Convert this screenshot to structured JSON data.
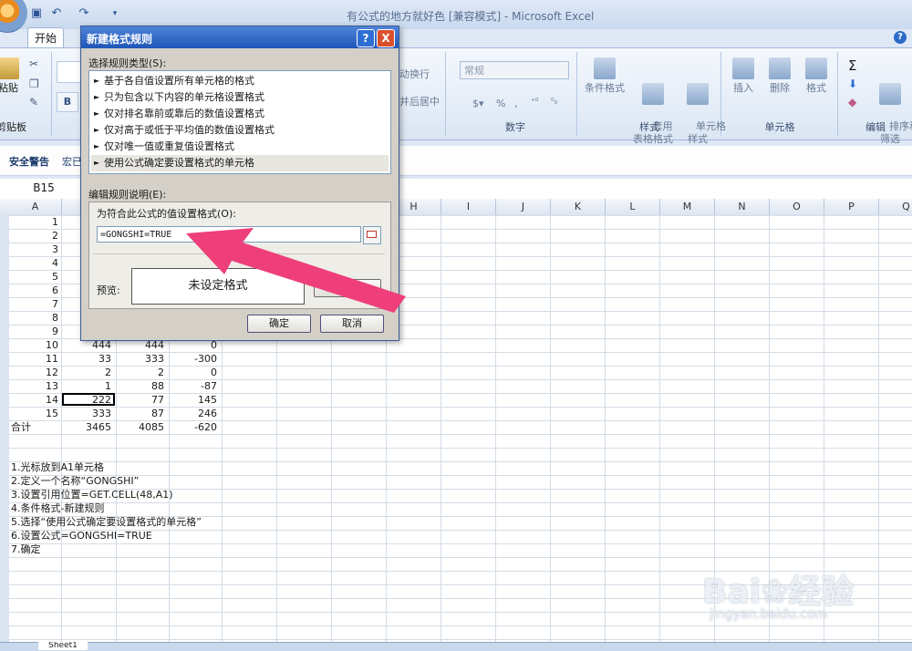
{
  "window": {
    "title": "有公式的地方就好色  [兼容模式] - Microsoft Excel",
    "help": "?"
  },
  "tabs": {
    "home": "开始"
  },
  "ribbon": {
    "paste": "粘贴",
    "clipboard": "剪贴板",
    "bold": "B",
    "wrap": "动换行",
    "merge": "并后居中",
    "number_format": "常规",
    "percent": "%",
    "comma": ",",
    "number_group": "数字",
    "cond_format": "条件格式",
    "table_format": "套用\n表格格式",
    "cell_style": "单元格\n样式",
    "style_group": "样式",
    "insert": "插入",
    "delete": "删除",
    "format": "格式",
    "cells_group": "单元格",
    "sort_filter": "排序和\n筛选",
    "edit_group": "编辑",
    "sigma": "Σ"
  },
  "security": {
    "warning": "安全警告",
    "macro": "宏已"
  },
  "formula_bar": {
    "name_box": "B15"
  },
  "columns": [
    "A",
    "",
    "",
    "",
    "",
    "",
    "",
    "H",
    "I",
    "J",
    "K",
    "L",
    "M",
    "N",
    "O",
    "P",
    "Q"
  ],
  "rows": [
    {
      "a": "1",
      "b": "",
      "c": "",
      "d": ""
    },
    {
      "a": "2",
      "b": "",
      "c": "",
      "d": ""
    },
    {
      "a": "3",
      "b": "",
      "c": "",
      "d": ""
    },
    {
      "a": "4",
      "b": "",
      "c": "",
      "d": ""
    },
    {
      "a": "5",
      "b": "",
      "c": "",
      "d": ""
    },
    {
      "a": "6",
      "b": "",
      "c": "",
      "d": ""
    },
    {
      "a": "7",
      "b": "",
      "c": "",
      "d": ""
    },
    {
      "a": "8",
      "b": "",
      "c": "",
      "d": ""
    },
    {
      "a": "9",
      "b": "",
      "c": "",
      "d": ""
    },
    {
      "a": "10",
      "b": "444",
      "c": "444",
      "d": "0"
    },
    {
      "a": "11",
      "b": "33",
      "c": "333",
      "d": "-300"
    },
    {
      "a": "12",
      "b": "2",
      "c": "2",
      "d": "0"
    },
    {
      "a": "13",
      "b": "1",
      "c": "88",
      "d": "-87"
    },
    {
      "a": "14",
      "b": "222",
      "c": "77",
      "d": "145"
    },
    {
      "a": "15",
      "b": "333",
      "c": "87",
      "d": "246"
    }
  ],
  "total": {
    "label": "合计",
    "b": "3465",
    "c": "4085",
    "d": "-620"
  },
  "notes": [
    "1.光标放到A1单元格",
    "2.定义一个名称“GONGSHI”",
    "3.设置引用位置=GET.CELL(48,A1)",
    "4.条件格式-新建规则",
    "5.选择“使用公式确定要设置格式的单元格”",
    "6.设置公式=GONGSHI=TRUE",
    "7.确定"
  ],
  "sheet_tab": "Sheet1",
  "dialog": {
    "title": "新建格式规则",
    "help": "?",
    "close": "X",
    "rule_type_label": "选择规则类型(S):",
    "rule_types": [
      "基于各自值设置所有单元格的格式",
      "只为包含以下内容的单元格设置格式",
      "仅对排名靠前或靠后的数值设置格式",
      "仅对高于或低于平均值的数值设置格式",
      "仅对唯一值或重复值设置格式",
      "使用公式确定要设置格式的单元格"
    ],
    "selected_index": 5,
    "desc_label": "编辑规则说明(E):",
    "formula_label": "为符合此公式的值设置格式(O):",
    "formula_value": "=GONGSHI=TRUE",
    "preview_label": "预览:",
    "preview_text": "未设定格式",
    "format_button": "格式(F)...",
    "ok": "确定",
    "cancel": "取消"
  },
  "annotation": {
    "color": "#ee3f7a"
  },
  "watermark": {
    "brand": "Bai❀经验",
    "url": "jingyan.baidu.com"
  }
}
